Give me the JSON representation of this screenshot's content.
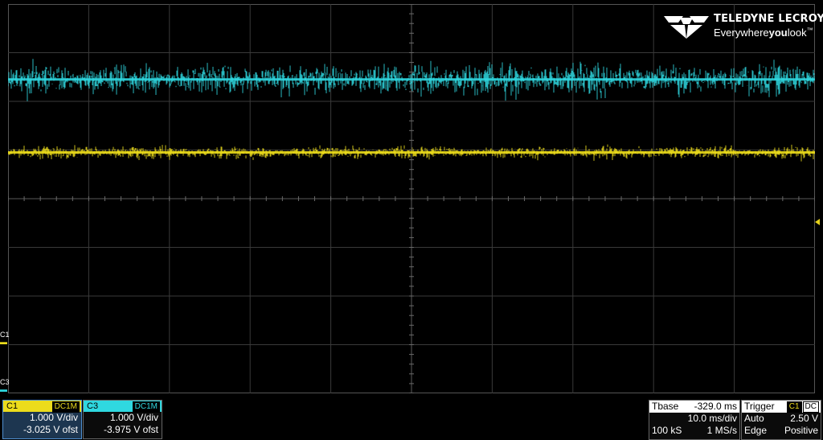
{
  "brand": {
    "name": "TELEDYNE LECROY",
    "tagline_a": "Everywhere",
    "tagline_b": "you",
    "tagline_c": "look",
    "tm": "™"
  },
  "colors": {
    "c1": "#ecdc1c",
    "c3": "#2fd8e0",
    "grid": "#3a3a3a",
    "background": "#000000"
  },
  "grid": {
    "h_divs": 10,
    "v_divs": 8
  },
  "side_labels": {
    "c1": "C1",
    "c3": "C3"
  },
  "traces": [
    {
      "channel": "C1",
      "level_div": 3.05,
      "noise_div": 0.07
    },
    {
      "channel": "C3",
      "level_div": 1.55,
      "noise_div": 0.17
    }
  ],
  "channels": [
    {
      "name": "C1",
      "coupling": "DC1M",
      "vdiv": "1.000 V/div",
      "offset": "-3.025 V ofst"
    },
    {
      "name": "C3",
      "coupling": "DC1M",
      "vdiv": "1.000 V/div",
      "offset": "-3.975 V ofst"
    }
  ],
  "timebase": {
    "label": "Tbase",
    "delay": "-329.0 ms",
    "tdiv": "10.0 ms/div",
    "samples": "100 kS",
    "rate": "1 MS/s"
  },
  "trigger": {
    "label": "Trigger",
    "source": "C1",
    "coupling": "DC",
    "mode": "Auto",
    "level": "2.50 V",
    "type": "Edge",
    "slope": "Positive"
  }
}
